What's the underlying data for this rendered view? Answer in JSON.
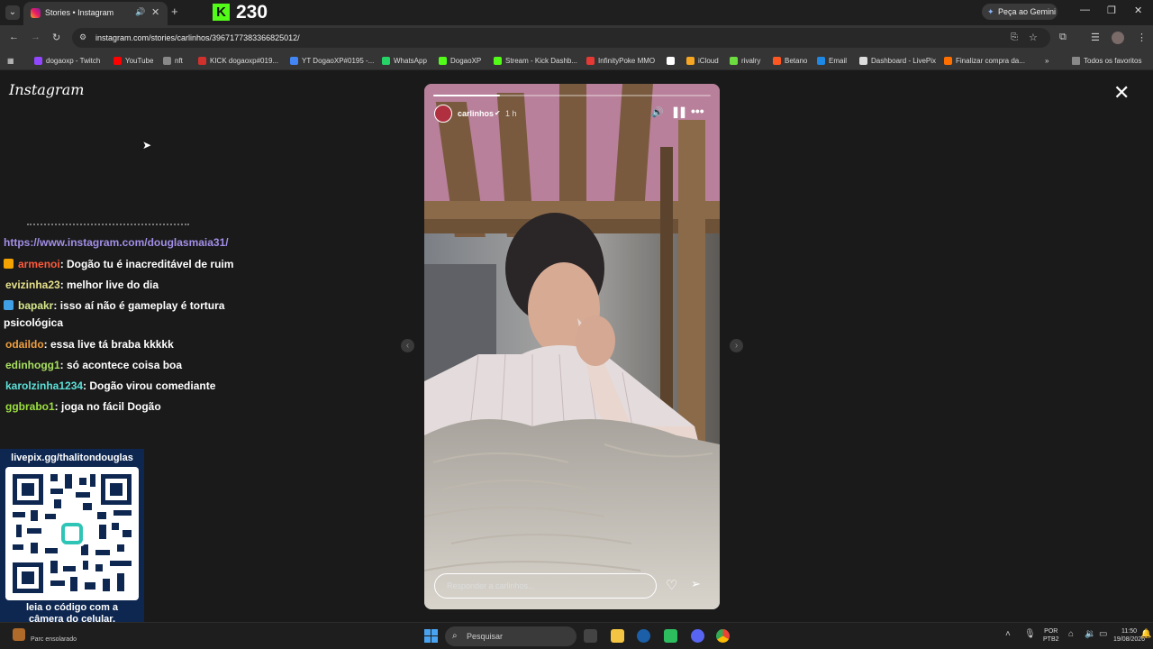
{
  "browser": {
    "tab_title": "Stories • Instagram",
    "new_tab_symbol": "+",
    "tab_close_symbol": "✕",
    "kick_viewer_count": "230",
    "kick_logo_letter": "K",
    "gemini_label": "Peça ao Gemini",
    "url": "instagram.com/stories/carlinhos/3967177383366825012/",
    "bookmarks": [
      {
        "label": "dogaoxp - Twitch",
        "color": "#9146ff"
      },
      {
        "label": "YouTube",
        "color": "#ff0000"
      },
      {
        "label": "nft",
        "color": "#888888"
      },
      {
        "label": "KICK dogaoxp#019...",
        "color": "#d0312d"
      },
      {
        "label": "YT DogaoXP#0195 -...",
        "color": "#4285f4"
      },
      {
        "label": "WhatsApp",
        "color": "#25d366"
      },
      {
        "label": "DogaoXP",
        "color": "#53fc18"
      },
      {
        "label": "Stream - Kick Dashb...",
        "color": "#53fc18"
      },
      {
        "label": "InfinityPoke MMO",
        "color": "#e53935"
      },
      {
        "label": "",
        "color": "#ffffff"
      },
      {
        "label": "iCloud",
        "color": "#f5a623"
      },
      {
        "label": "rivalry",
        "color": "#6ddc3f"
      },
      {
        "label": "Betano",
        "color": "#ff5722"
      },
      {
        "label": "Email",
        "color": "#1e88e5"
      },
      {
        "label": "Dashboard - LivePix",
        "color": "#dddddd"
      },
      {
        "label": "Finalizar compra da...",
        "color": "#ff6f00"
      }
    ],
    "more_bookmarks_symbol": "»",
    "all_favorites_label": "Todos os favoritos"
  },
  "page": {
    "logo": "Instagram",
    "close_symbol": "✕",
    "prev_symbol": "‹",
    "next_symbol": "›"
  },
  "chat": {
    "link": "https://www.instagram.com/douglasmaia31/",
    "messages": [
      {
        "user": "armenoi",
        "text": ": Dogão tu é inacreditável de ruim",
        "color": "#ff5a3c",
        "badge": "#f4a300"
      },
      {
        "user": "evizinha23",
        "text": ": melhor live do dia",
        "color": "#e6e08a",
        "badge": ""
      },
      {
        "user": "bapakr",
        "text": ": isso aí não é gameplay é tortura",
        "text2": "psicológica",
        "color": "#d6e88c",
        "badge": "#3fa0e6"
      },
      {
        "user": "odaildo",
        "text": ": essa live tá braba kkkkk",
        "color": "#f0a040",
        "badge": ""
      },
      {
        "user": "edinhogg1",
        "text": ": só acontece coisa boa",
        "color": "#a8e060",
        "badge": ""
      },
      {
        "user": "karolzinha1234",
        "text": ": Dogão virou comediante",
        "color": "#5ce0d8",
        "badge": ""
      },
      {
        "user": "ggbrabo1",
        "text": ": joga no fácil Dogão",
        "color": "#9ce040",
        "badge": ""
      }
    ]
  },
  "qr": {
    "url": "livepix.gg/thalitondouglas",
    "caption_line1": "leia o código com a",
    "caption_line2": "câmera do celular."
  },
  "story": {
    "username": "carlinhos",
    "verified_symbol": "✔",
    "time": "1 h",
    "progress": 0.24,
    "reply_placeholder": "Responder a carlinhos...",
    "heart_symbol": "♡",
    "send_symbol": "➢",
    "more_symbol": "•••"
  },
  "taskbar": {
    "weather": "Parc ensolarado",
    "search_placeholder": "Pesquisar",
    "lang_line1": "POR",
    "lang_line2": "PTB2",
    "time": "11:50",
    "date": "19/08/2026"
  },
  "colors": {
    "kick_green": "#53fc18",
    "chat_link": "#a28ee6",
    "qr_bg": "#0e2750",
    "page_bg": "#1a1a1a"
  }
}
